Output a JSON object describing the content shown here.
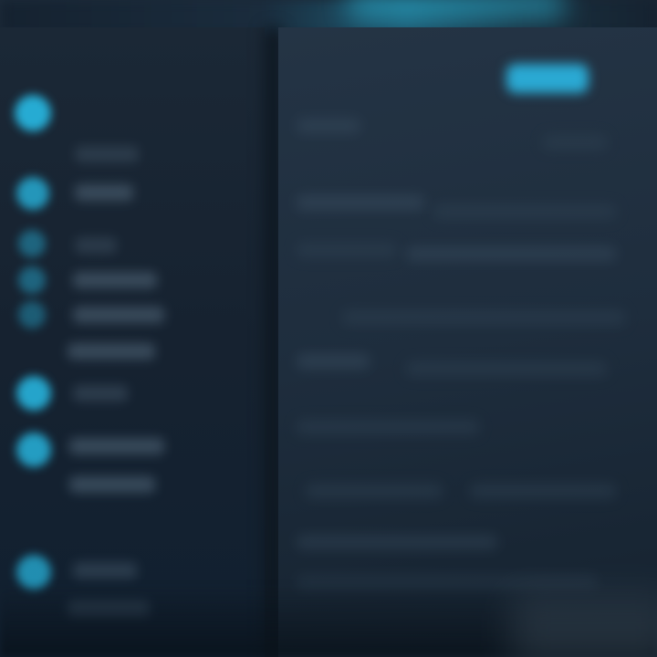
{
  "window": {
    "sidebar_title": "",
    "main_title": "",
    "primary_button_label": ""
  },
  "colors": {
    "accent": "#2ab3dc",
    "sidebar_bg": "#17222f",
    "main_bg": "#1e2d3d",
    "text_muted": "#6f8598"
  },
  "sidebar": {
    "items": [
      {
        "icon": "circle-icon"
      },
      {
        "icon": "circle-icon"
      },
      {
        "icon": "circle-icon"
      },
      {
        "icon": "circle-icon"
      },
      {
        "icon": "circle-icon"
      },
      {
        "icon": "circle-icon"
      },
      {
        "icon": "circle-icon"
      },
      {
        "icon": "circle-icon"
      }
    ]
  }
}
